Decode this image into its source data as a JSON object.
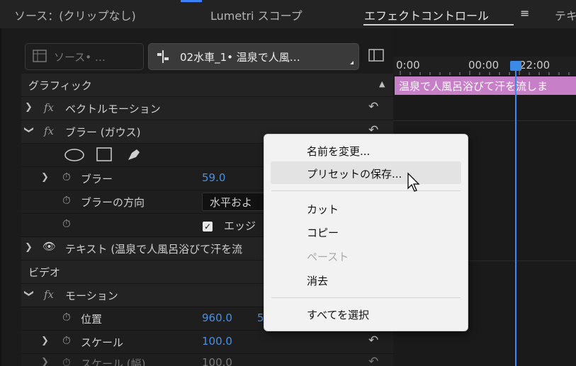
{
  "tabs": [
    {
      "label": "ソース：(クリップなし)"
    },
    {
      "label": "Lumetri スコープ"
    },
    {
      "label": "エフェクトコントロール"
    },
    {
      "label": "テキ"
    }
  ],
  "tab_menu_icon": "≡",
  "source_selector": {
    "label": "ソース• …"
  },
  "clip_selector": {
    "label": "02水車_1• 温泉で人風…"
  },
  "timeline": {
    "time_start": "0:00",
    "time_mid": "00:00",
    "time_end": "22:00",
    "clip_label": "温泉で人風呂浴びて汗を流しま"
  },
  "sections": {
    "graphics": "グラフィック",
    "video": "ビデオ"
  },
  "effects": {
    "vector_motion": "ベクトルモーション",
    "gaussian_blur": "ブラー (ガウス)",
    "blur_label": "ブラー",
    "blur_value": "59.0",
    "blur_direction_label": "ブラーの方向",
    "blur_direction_value": "水平およ",
    "edge_label": "エッジ",
    "text_layer": "テキスト (温泉で人風呂浴びて汗を流",
    "motion": "モーション",
    "position_label": "位置",
    "position_x": "960.0",
    "position_y": "5",
    "scale_label": "スケール",
    "scale_value": "100.0",
    "scale_width_label": "スケール (幅)",
    "scale_width_value": "100.0"
  },
  "context_menu": {
    "rename": "名前を変更...",
    "save_preset": "プリセットの保存...",
    "cut": "カット",
    "copy": "コピー",
    "paste": "ペースト",
    "clear": "消去",
    "select_all": "すべてを選択"
  },
  "colors": {
    "accent_blue": "#4a90e2",
    "clip_pink": "#c77fc7",
    "playhead": "#3c8ae8"
  }
}
